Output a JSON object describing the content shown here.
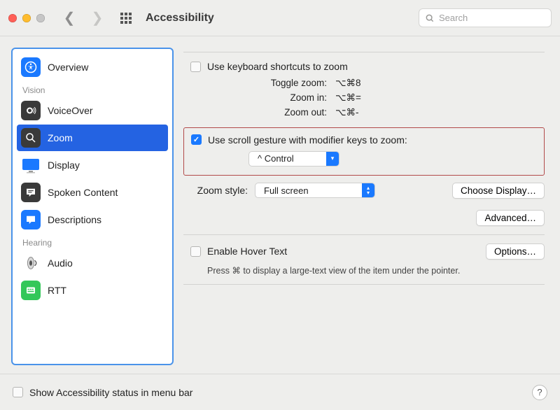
{
  "window": {
    "title": "Accessibility"
  },
  "search": {
    "placeholder": "Search"
  },
  "sidebar": {
    "sections": [
      {
        "label": null,
        "items": [
          {
            "label": "Overview"
          }
        ]
      },
      {
        "label": "Vision",
        "items": [
          {
            "label": "VoiceOver"
          },
          {
            "label": "Zoom",
            "selected": true
          },
          {
            "label": "Display"
          },
          {
            "label": "Spoken Content"
          },
          {
            "label": "Descriptions"
          }
        ]
      },
      {
        "label": "Hearing",
        "items": [
          {
            "label": "Audio"
          },
          {
            "label": "RTT"
          }
        ]
      }
    ]
  },
  "zoom": {
    "use_keyboard_label": "Use keyboard shortcuts to zoom",
    "shortcuts": {
      "toggle_label": "Toggle zoom:",
      "toggle_value": "⌥⌘8",
      "in_label": "Zoom in:",
      "in_value": "⌥⌘=",
      "out_label": "Zoom out:",
      "out_value": "⌥⌘-"
    },
    "scroll_gesture_label": "Use scroll gesture with modifier keys to zoom:",
    "scroll_gesture_checked": true,
    "modifier_selected": "^ Control",
    "zoom_style_label": "Zoom style:",
    "zoom_style_selected": "Full screen",
    "choose_display_label": "Choose Display…",
    "advanced_label": "Advanced…",
    "hover_text_label": "Enable Hover Text",
    "hover_text_hint": "Press ⌘ to display a large-text view of the item under the pointer.",
    "options_label": "Options…"
  },
  "footer": {
    "show_status_label": "Show Accessibility status in menu bar"
  }
}
